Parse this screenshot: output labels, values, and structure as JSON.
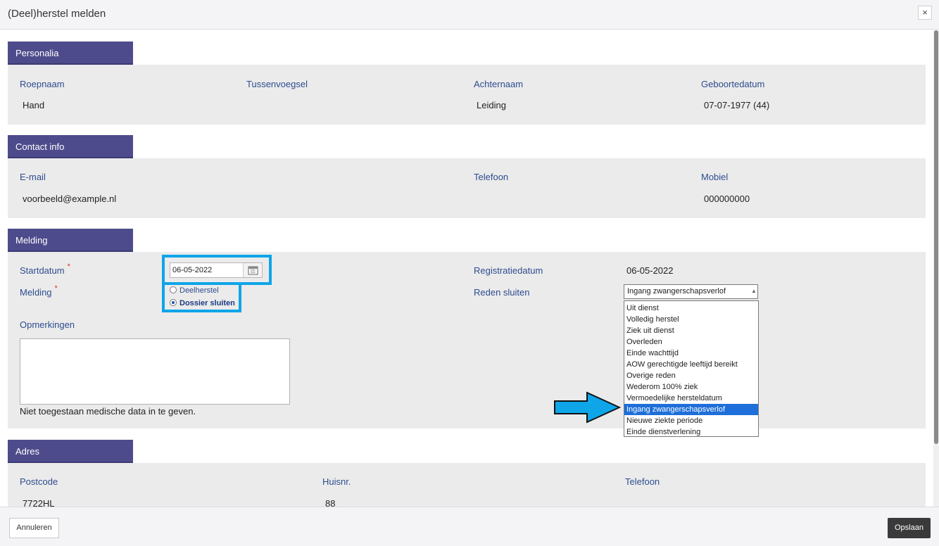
{
  "modal": {
    "title": "(Deel)herstel melden",
    "close_label": "×"
  },
  "personalia": {
    "title": "Personalia",
    "roepnaam_label": "Roepnaam",
    "roepnaam": "Hand",
    "tussenvoegsel_label": "Tussenvoegsel",
    "tussenvoegsel": "",
    "achternaam_label": "Achternaam",
    "achternaam": "Leiding",
    "geboortedatum_label": "Geboortedatum",
    "geboortedatum": "07-07-1977 (44)"
  },
  "contact": {
    "title": "Contact info",
    "email_label": "E-mail",
    "email": "voorbeeld@example.nl",
    "telefoon_label": "Telefoon",
    "telefoon": "",
    "mobiel_label": "Mobiel",
    "mobiel": "000000000"
  },
  "melding": {
    "title": "Melding",
    "startdatum_label": "Startdatum",
    "startdatum": "06-05-2022",
    "required_mark": "*",
    "melding_label": "Melding",
    "option_deelherstel": "Deelherstel",
    "option_dossier_sluiten": "Dossier sluiten",
    "selected_option": "Dossier sluiten",
    "registratiedatum_label": "Registratiedatum",
    "registratiedatum": "06-05-2022",
    "reden_label": "Reden sluiten",
    "reden_value": "Ingang zwangerschapsverlof",
    "opmerkingen_label": "Opmerkingen",
    "opmerkingen": "",
    "hint": "Niet toegestaan medische data in te geven.",
    "reden_options": [
      "Uit dienst",
      "Volledig herstel",
      "Ziek uit dienst",
      "Overleden",
      "Einde wachttijd",
      "AOW gerechtigde leeftijd bereikt",
      "Overige reden",
      "Wederom 100% ziek",
      "Vermoedelijke hersteldatum",
      "Ingang zwangerschapsverlof",
      "Nieuwe ziekte periode",
      "Einde dienstverlening"
    ]
  },
  "adres": {
    "title": "Adres",
    "postcode_label": "Postcode",
    "postcode": "7722HL",
    "huisnr_label": "Huisnr.",
    "huisnr": "88",
    "telefoon_label": "Telefoon",
    "telefoon": ""
  },
  "footer": {
    "cancel_label": "Annuleren",
    "save_label": "Opslaan"
  },
  "colors": {
    "section_header": "#4e4b8c",
    "label": "#2d4c8f",
    "highlight": "#0ea5e9",
    "selected": "#1e6fd9"
  }
}
